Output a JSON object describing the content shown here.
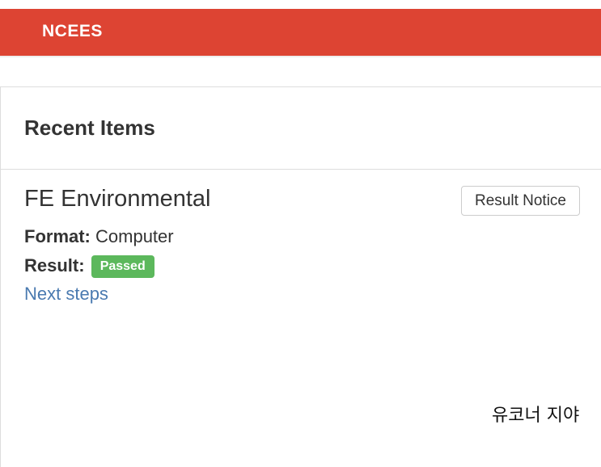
{
  "header": {
    "logo_text": "NCEES",
    "background_color": "#dd4433"
  },
  "recent_items": {
    "heading": "Recent Items",
    "items": [
      {
        "title": "FE Environmental",
        "result_notice_label": "Result Notice",
        "format_label": "Format:",
        "format_value": "Computer",
        "result_label": "Result:",
        "result_value": "Passed",
        "result_color": "#5cb85c",
        "next_steps_label": "Next steps"
      }
    ]
  },
  "watermark": {
    "text": "유코너 지야"
  }
}
